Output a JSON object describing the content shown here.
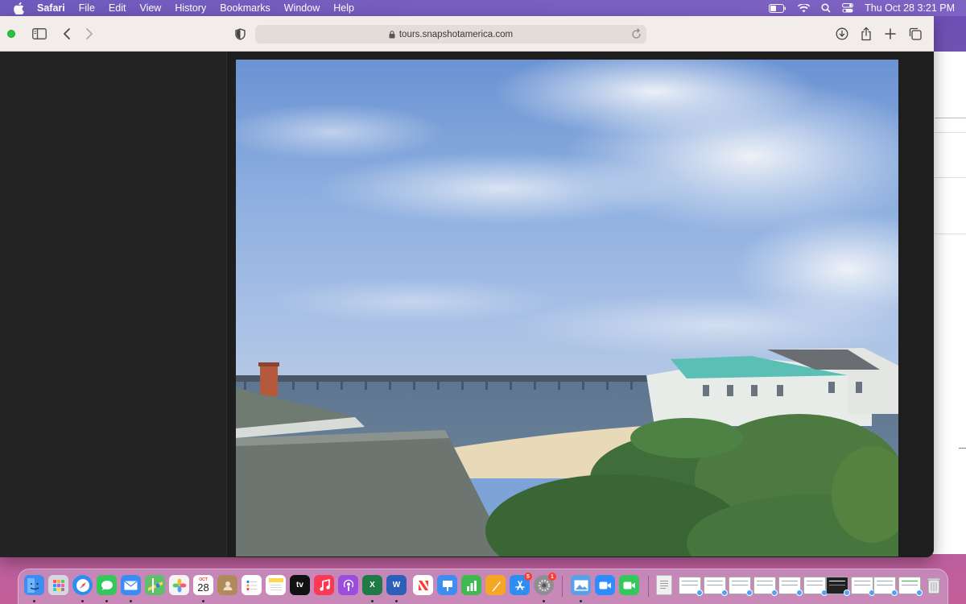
{
  "menubar": {
    "app_name": "Safari",
    "items": [
      "File",
      "Edit",
      "View",
      "History",
      "Bookmarks",
      "Window",
      "Help"
    ],
    "clock": "Thu Oct 28  3:21 PM",
    "status_icons": [
      "battery-icon",
      "wifi-icon",
      "spotlight-search-icon",
      "control-center-icon"
    ]
  },
  "toolbar": {
    "url": "tours.snapshotamerica.com",
    "icons": [
      "sidebar-toggle-icon",
      "back-icon",
      "forward-icon",
      "privacy-shield-icon",
      "download-icon",
      "share-icon",
      "new-tab-icon",
      "tab-overview-icon"
    ]
  },
  "dock": {
    "apps": [
      {
        "name": "Finder",
        "icon": "finder-icon",
        "color": "#3d8ef0"
      },
      {
        "name": "Launchpad",
        "icon": "launchpad-icon",
        "color": "#d7d7e0"
      },
      {
        "name": "Safari",
        "icon": "safari-icon",
        "color": "#2b8ef5"
      },
      {
        "name": "Messages",
        "icon": "messages-icon",
        "color": "#34c759"
      },
      {
        "name": "Mail",
        "icon": "mail-icon",
        "color": "#3a8cf3"
      },
      {
        "name": "Maps",
        "icon": "maps-icon",
        "color": "#5fbf6a"
      },
      {
        "name": "Photos",
        "icon": "photos-icon",
        "color": "#f4f4f4"
      },
      {
        "name": "Calendar",
        "icon": "calendar-icon",
        "color": "#ffffff",
        "label_top": "OCT",
        "label": "28"
      },
      {
        "name": "Contacts",
        "icon": "contacts-icon",
        "color": "#b08a5a"
      },
      {
        "name": "Reminders",
        "icon": "reminders-icon",
        "color": "#ffffff"
      },
      {
        "name": "Notes",
        "icon": "notes-icon",
        "color": "#ffd84a"
      },
      {
        "name": "TV",
        "icon": "apple-tv-icon",
        "color": "#111111",
        "label": "tv"
      },
      {
        "name": "Music",
        "icon": "music-icon",
        "color": "#fa3a55"
      },
      {
        "name": "Podcasts",
        "icon": "podcasts-icon",
        "color": "#9b4de0"
      },
      {
        "name": "Excel",
        "icon": "excel-icon",
        "color": "#1f7a45",
        "label": "X"
      },
      {
        "name": "Word",
        "icon": "word-icon",
        "color": "#2b5fb8",
        "label": "W"
      },
      {
        "name": "News",
        "icon": "news-icon",
        "color": "#ffffff"
      },
      {
        "name": "Keynote",
        "icon": "keynote-icon",
        "color": "#3d8ef0"
      },
      {
        "name": "Numbers",
        "icon": "numbers-icon",
        "color": "#3fb950"
      },
      {
        "name": "Pages",
        "icon": "pages-icon",
        "color": "#f5a623"
      },
      {
        "name": "App Store",
        "icon": "app-store-icon",
        "color": "#2f8cf0",
        "badge": "5"
      },
      {
        "name": "System Preferences",
        "icon": "system-preferences-icon",
        "color": "#8e8e93",
        "badge": "1"
      },
      {
        "name": "Preview",
        "icon": "preview-icon",
        "color": "#5aa0e6"
      },
      {
        "name": "Zoom",
        "icon": "zoom-icon",
        "color": "#2d8cff"
      },
      {
        "name": "FaceTime",
        "icon": "facetime-icon",
        "color": "#34c759"
      },
      {
        "name": "Document",
        "icon": "document-icon",
        "color": "#f0f0f0"
      }
    ],
    "window_thumbnails": 10,
    "trash_icon": "trash-icon"
  }
}
